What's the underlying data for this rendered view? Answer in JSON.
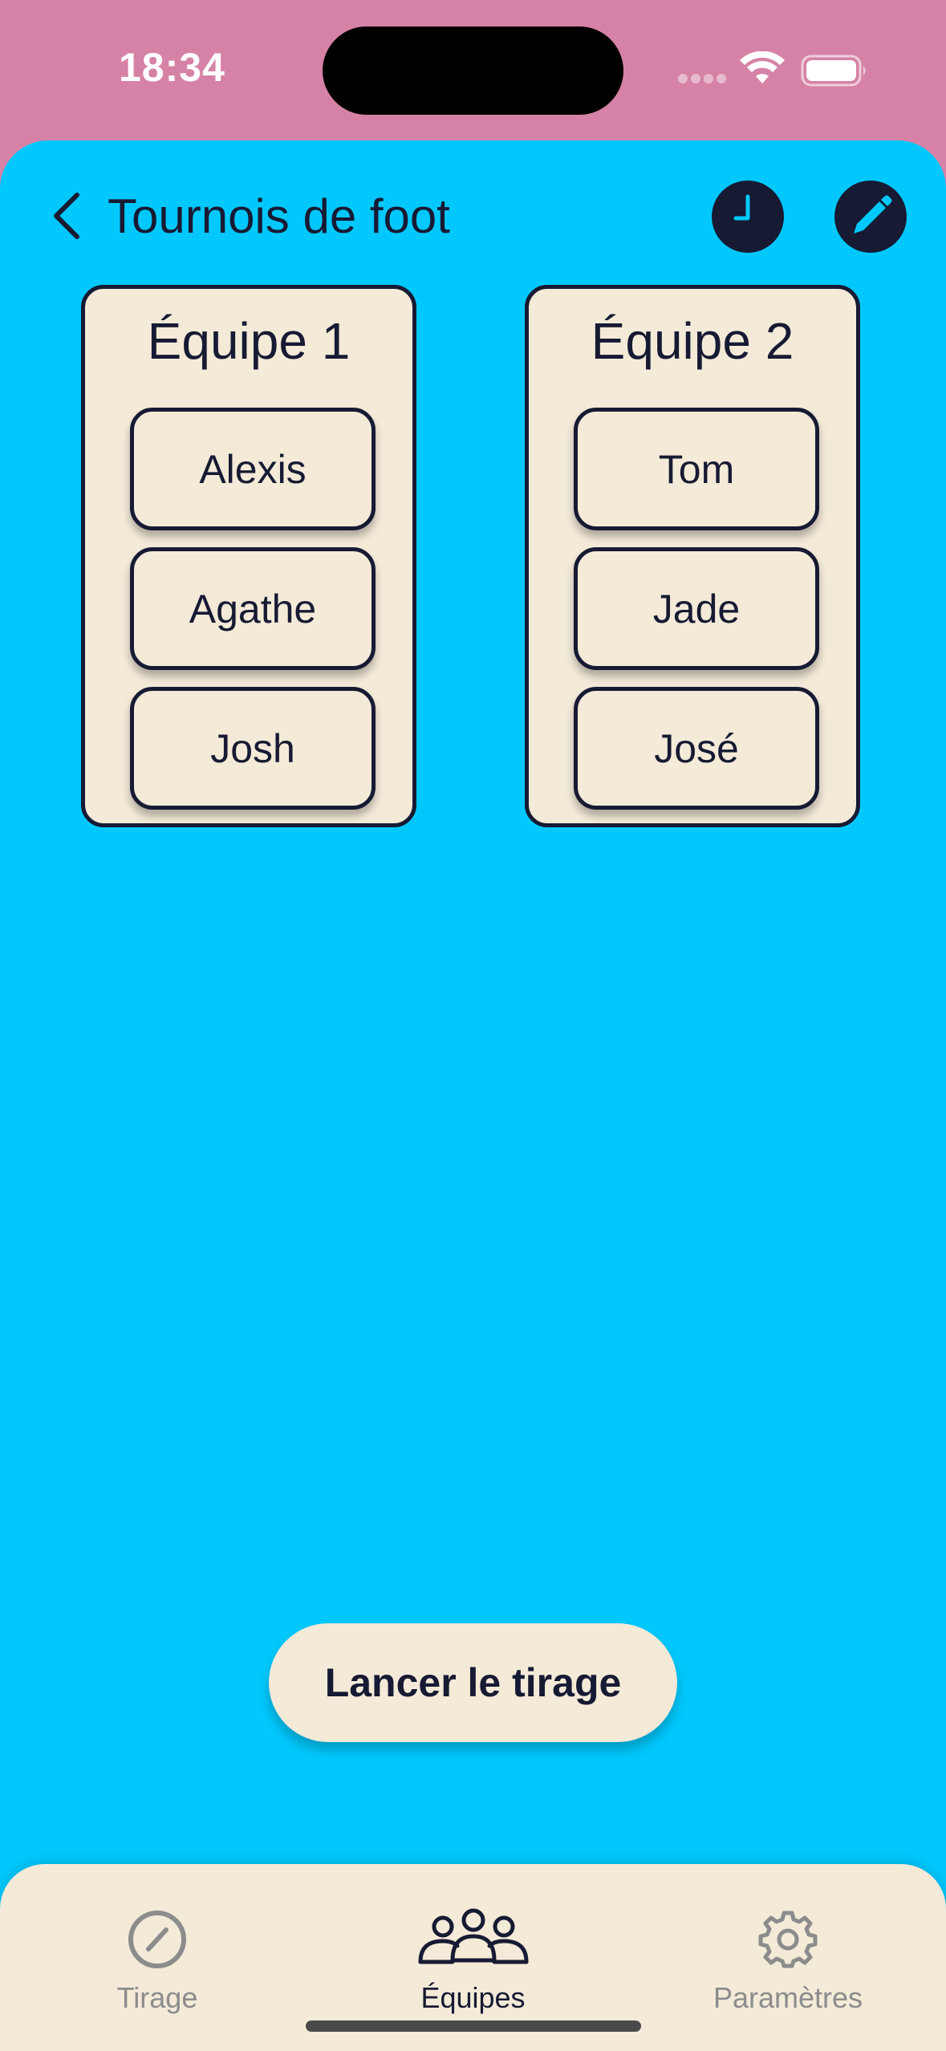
{
  "status_bar": {
    "time": "18:34"
  },
  "nav": {
    "title": "Tournois de foot",
    "back_icon": "chevron-left-icon",
    "history_icon": "clock-icon",
    "edit_icon": "pencil-icon"
  },
  "teams": [
    {
      "title": "Équipe 1",
      "members": [
        "Alexis",
        "Agathe",
        "Josh"
      ]
    },
    {
      "title": "Équipe 2",
      "members": [
        "Tom",
        "Jade",
        "José"
      ]
    }
  ],
  "launch_button": {
    "label": "Lancer le tirage"
  },
  "tab_bar": {
    "tabs": [
      {
        "label": "Tirage",
        "icon": "compass-icon",
        "active": false
      },
      {
        "label": "Équipes",
        "icon": "people-icon",
        "active": true
      },
      {
        "label": "Paramètres",
        "icon": "gear-icon",
        "active": false
      }
    ]
  },
  "colors": {
    "status_background": "#d682a6",
    "main_background": "#00c8fc",
    "card_background": "#f3ead8",
    "ink": "#171a33",
    "inactive_tab": "#8c8c8c"
  }
}
